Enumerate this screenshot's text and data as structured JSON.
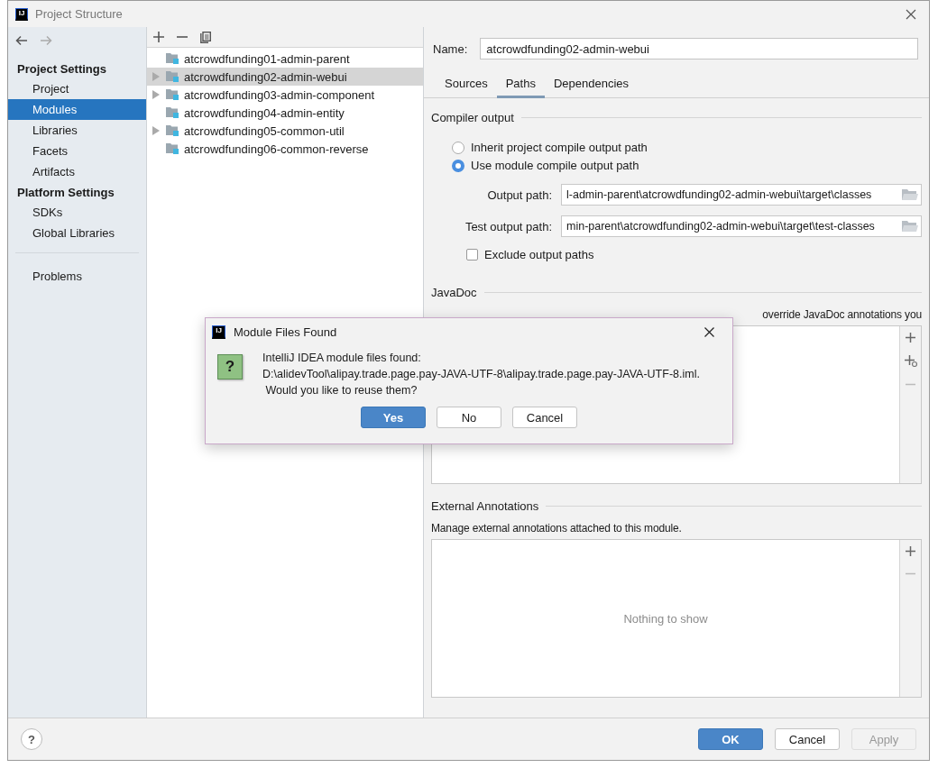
{
  "window": {
    "title": "Project Structure",
    "logo": "IJ"
  },
  "sidebar": {
    "sections": [
      {
        "heading": "Project Settings",
        "items": [
          {
            "label": "Project",
            "selected": false
          },
          {
            "label": "Modules",
            "selected": true
          },
          {
            "label": "Libraries",
            "selected": false
          },
          {
            "label": "Facets",
            "selected": false
          },
          {
            "label": "Artifacts",
            "selected": false
          }
        ]
      },
      {
        "heading": "Platform Settings",
        "items": [
          {
            "label": "SDKs",
            "selected": false
          },
          {
            "label": "Global Libraries",
            "selected": false
          }
        ]
      }
    ],
    "problems": {
      "label": "Problems",
      "selected": false
    }
  },
  "modules": [
    {
      "name": "atcrowdfunding01-admin-parent",
      "expandable": false,
      "selected": false
    },
    {
      "name": "atcrowdfunding02-admin-webui",
      "expandable": true,
      "selected": true
    },
    {
      "name": "atcrowdfunding03-admin-component",
      "expandable": true,
      "selected": false
    },
    {
      "name": "atcrowdfunding04-admin-entity",
      "expandable": false,
      "selected": false
    },
    {
      "name": "atcrowdfunding05-common-util",
      "expandable": true,
      "selected": false
    },
    {
      "name": "atcrowdfunding06-common-reverse",
      "expandable": false,
      "selected": false
    }
  ],
  "name_field": {
    "label": "Name:",
    "value": "atcrowdfunding02-admin-webui"
  },
  "tabs": [
    {
      "label": "Sources",
      "selected": false
    },
    {
      "label": "Paths",
      "selected": true
    },
    {
      "label": "Dependencies",
      "selected": false
    }
  ],
  "compiler_output": {
    "title": "Compiler output",
    "options": [
      {
        "label": "Inherit project compile output path",
        "selected": false
      },
      {
        "label": "Use module compile output path",
        "selected": true
      }
    ],
    "paths": [
      {
        "label": "Output path:",
        "value": "l-admin-parent\\atcrowdfunding02-admin-webui\\target\\classes"
      },
      {
        "label": "Test output path:",
        "value": "min-parent\\atcrowdfunding02-admin-webui\\target\\test-classes"
      }
    ],
    "exclude": {
      "label": "Exclude output paths",
      "checked": false
    }
  },
  "javadoc": {
    "title": "JavaDoc",
    "description": "override JavaDoc annotations you"
  },
  "external_annotations": {
    "title": "External Annotations",
    "description": "Manage external annotations attached to this module.",
    "empty_text": "Nothing to show"
  },
  "help": {
    "label": "?"
  },
  "buttons": [
    {
      "label": "OK",
      "primary": true,
      "disabled": false
    },
    {
      "label": "Cancel",
      "primary": false,
      "disabled": false
    },
    {
      "label": "Apply",
      "primary": false,
      "disabled": true
    }
  ],
  "dialog": {
    "title": "Module Files Found",
    "logo": "IJ",
    "icon": "?",
    "message": [
      "IntelliJ IDEA module files found:",
      "D:\\alidevTool\\alipay.trade.page.pay-JAVA-UTF-8\\alipay.trade.page.pay-JAVA-UTF-8.iml.",
      " Would you like to reuse them?"
    ],
    "buttons": [
      {
        "label": "Yes",
        "primary": true
      },
      {
        "label": "No",
        "primary": false
      },
      {
        "label": "Cancel",
        "primary": false
      }
    ]
  }
}
